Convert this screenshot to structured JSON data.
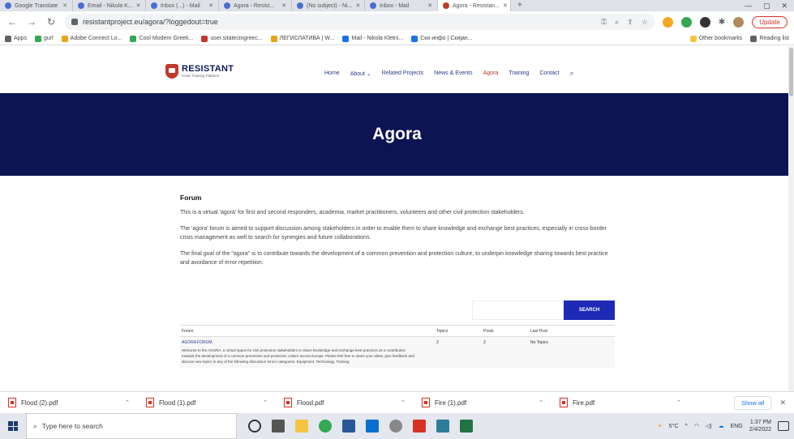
{
  "tabs": [
    {
      "label": "Google Translate"
    },
    {
      "label": "Email - Nikola K..."
    },
    {
      "label": "Inbox (...) - Mail"
    },
    {
      "label": "Agora - Resist..."
    },
    {
      "label": "(No subject) - Ni..."
    },
    {
      "label": "Inbox - Mail"
    },
    {
      "label": "Agora - Resistan..."
    }
  ],
  "address": {
    "url": "resistantproject.eu/agora/?loggedout=true",
    "update_label": "Update"
  },
  "bookmarks": {
    "items": [
      {
        "label": "Apps",
        "color": "#5f6368"
      },
      {
        "label": "gurl",
        "color": "#34a853"
      },
      {
        "label": "Adobe Connect Lo...",
        "color": "#e8a317"
      },
      {
        "label": "Cool Modern Greek...",
        "color": "#34a853"
      },
      {
        "label": "user.sitatecingreec...",
        "color": "#c0392b"
      },
      {
        "label": "ЛЕГИСЛАТИВА | W...",
        "color": "#e8a317"
      },
      {
        "label": "Mail - Nikola Kletni...",
        "color": "#1a73e8"
      },
      {
        "label": "Ски инфо | Скијан...",
        "color": "#1a73e8"
      }
    ],
    "other": "Other bookmarks",
    "reading": "Reading list"
  },
  "site": {
    "logo_name": "RESISTANT",
    "logo_sub": "Crisis Training Platform",
    "nav": [
      "Home",
      "About ⌄",
      "Related Projects",
      "News & Events",
      "Agora",
      "Training",
      "Contact"
    ],
    "hero_title": "Agora"
  },
  "content": {
    "heading": "Forum",
    "p1": "This is a virtual 'agora' for first and second responders, academia, market practitioners, volunteers and other civil protection stakeholders.",
    "p2": "The 'agora' forum is aimed to support discussion among stakeholders in order to enable them to share knowledge and exchange best practices, especially in cross-border crisis management as well to search for synergies and future collaborations.",
    "p3": "The final goal of the \"agora\" is to contribute towards the development of a common prevention and protection culture, to underpin knowledge sharing towards best practice and avoidance of error repetition."
  },
  "search": {
    "placeholder": "",
    "button": "SEARCH"
  },
  "forum_table": {
    "headers": [
      "Forum",
      "Topics",
      "Posts",
      "Last Post"
    ],
    "rows": [
      {
        "forum": "AGORA FORUM",
        "desc": "Welcome to the AGORA, a virtual space for civil protection stakeholders to share knowledge and exchange best practices as a contribution towards the development of a common prevention and protection culture across Europe. Please feel free to share your ideas, give feedback and discuss new topics in any of the following discussion forum categories: Equipment, Technology, Training",
        "topics": "2",
        "posts": "2",
        "last": "No Topics"
      }
    ]
  },
  "downloads": {
    "items": [
      "Flood (2).pdf",
      "Flood (1).pdf",
      "Flood.pdf",
      "Fire (1).pdf",
      "Fire.pdf"
    ],
    "show_all": "Show all"
  },
  "taskbar": {
    "search_placeholder": "Type here to search",
    "weather": "5°C",
    "lang": "ENG",
    "time": "1:37 PM",
    "date": "2/4/2022"
  },
  "colors": {
    "navy": "#0d1452",
    "accent_red": "#c0392b",
    "search_blue": "#1e2ab5"
  }
}
